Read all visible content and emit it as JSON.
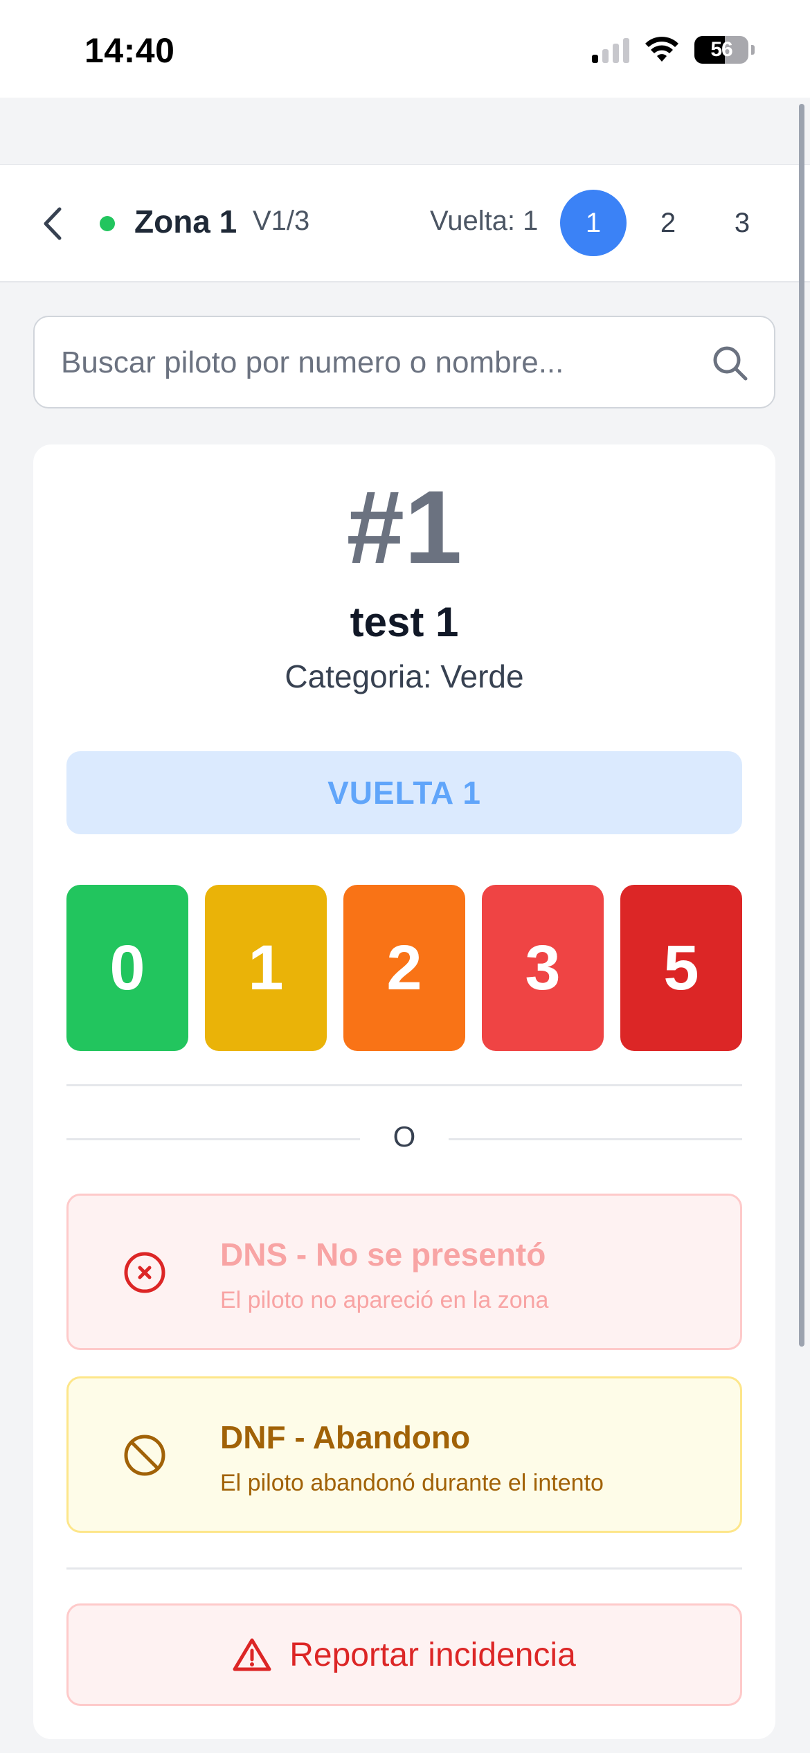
{
  "status_bar": {
    "time": "14:40",
    "battery": "56",
    "battery_level": 0.56,
    "signal_bars_on": 1
  },
  "header": {
    "zone_name": "Zona 1",
    "zone_status_color": "#22c55e",
    "version": "V1/3",
    "lap_label": "Vuelta: 1",
    "laps": [
      "1",
      "2",
      "3"
    ],
    "active_lap": "1"
  },
  "search": {
    "placeholder": "Buscar piloto por numero o nombre...",
    "value": ""
  },
  "pilot": {
    "number": "#1",
    "name": "test 1",
    "category": "Categoria: Verde"
  },
  "lap_banner": "VUELTA 1",
  "scores": [
    {
      "label": "0",
      "color": "#22c55e"
    },
    {
      "label": "1",
      "color": "#eab308"
    },
    {
      "label": "2",
      "color": "#f97316"
    },
    {
      "label": "3",
      "color": "#ef4444"
    },
    {
      "label": "5",
      "color": "#dc2626"
    }
  ],
  "separator_text": "O",
  "options": {
    "dns": {
      "title": "DNS - No se presentó",
      "description": "El piloto no apareció en la zona",
      "icon": "x-circle-icon"
    },
    "dnf": {
      "title": "DNF - Abandono",
      "description": "El piloto abandonó durante el intento",
      "icon": "ban-icon"
    }
  },
  "report": {
    "label": "Reportar incidencia",
    "icon": "warning-triangle-icon"
  },
  "colors": {
    "accent": "#3b82f6",
    "danger": "#dc2626",
    "warning": "#a16207"
  }
}
